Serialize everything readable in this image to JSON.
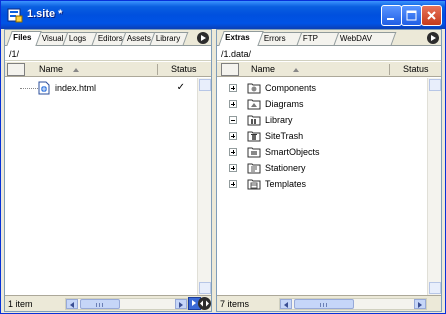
{
  "window": {
    "title": "1.site *",
    "title_icon": "dreamweaver-site-icon",
    "buttons": [
      "minimize",
      "maximize",
      "close"
    ]
  },
  "left_pane": {
    "tabs": [
      {
        "label": "Files",
        "active": true
      },
      {
        "label": "Visual",
        "active": false
      },
      {
        "label": "Logs",
        "active": false
      },
      {
        "label": "Editors",
        "active": false
      },
      {
        "label": "Assets",
        "active": false
      },
      {
        "label": "Library",
        "active": false
      }
    ],
    "path": "/1/",
    "columns": {
      "name": "Name",
      "status": "Status"
    },
    "items": [
      {
        "label": "index.html",
        "icon": "html-file-icon",
        "status": "✓"
      }
    ],
    "status_text": "1 item"
  },
  "right_pane": {
    "tabs": [
      {
        "label": "Extras",
        "active": true
      },
      {
        "label": "Errors",
        "active": false
      },
      {
        "label": "FTP",
        "active": false
      },
      {
        "label": "WebDAV",
        "active": false
      }
    ],
    "path": "/1.data/",
    "columns": {
      "name": "Name",
      "status": "Status"
    },
    "items": [
      {
        "label": "Components",
        "icon": "components-folder-icon",
        "expanded": false
      },
      {
        "label": "Diagrams",
        "icon": "diagrams-folder-icon",
        "expanded": false
      },
      {
        "label": "Library",
        "icon": "library-folder-icon",
        "expanded": true
      },
      {
        "label": "SiteTrash",
        "icon": "trash-folder-icon",
        "expanded": false
      },
      {
        "label": "SmartObjects",
        "icon": "smartobjects-folder-icon",
        "expanded": false
      },
      {
        "label": "Stationery",
        "icon": "stationery-folder-icon",
        "expanded": false
      },
      {
        "label": "Templates",
        "icon": "templates-folder-icon",
        "expanded": false
      }
    ],
    "status_text": "7 items"
  },
  "colors": {
    "titlebar": "#0053E6",
    "chrome": "#ECE9D8",
    "pane_border": "#7F9DB9"
  }
}
